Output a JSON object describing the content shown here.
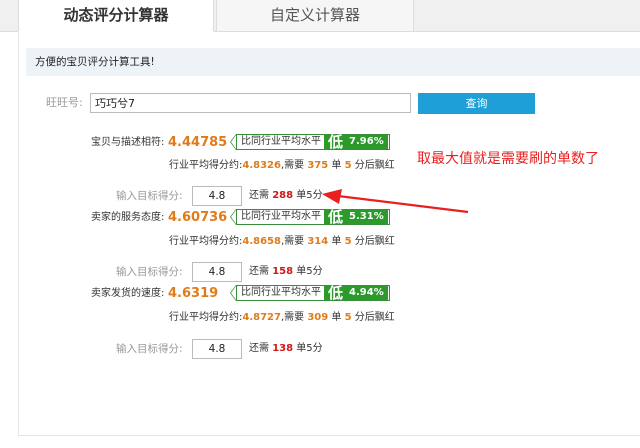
{
  "tabs": [
    {
      "label": "动态评分计算器",
      "active": true
    },
    {
      "label": "自定义计算器",
      "active": false
    }
  ],
  "notice": "方便的宝贝评分计算工具!",
  "search": {
    "label": "旺旺号:",
    "value": "巧巧兮7",
    "button": "查询"
  },
  "metrics": [
    {
      "label": "宝贝与描述相符:",
      "score": "4.44785",
      "compare_text": "比同行业平均水平",
      "level": "低",
      "percent": "7.96%",
      "avg_prefix": "行业平均得分约:",
      "avg": "4.8326",
      "need_prefix": ",需要",
      "need_count": "375",
      "unit1": "单",
      "star": "5",
      "suffix": "分后飘红",
      "target_label": "输入目标得分:",
      "target_value": "4.8",
      "remain_prefix": "还需",
      "remain_count": "288",
      "remain_suffix": "单5分"
    },
    {
      "label": "卖家的服务态度:",
      "score": "4.60736",
      "compare_text": "比同行业平均水平",
      "level": "低",
      "percent": "5.31%",
      "avg_prefix": "行业平均得分约:",
      "avg": "4.8658",
      "need_prefix": ",需要",
      "need_count": "314",
      "unit1": "单",
      "star": "5",
      "suffix": "分后飘红",
      "target_label": "输入目标得分:",
      "target_value": "4.8",
      "remain_prefix": "还需",
      "remain_count": "158",
      "remain_suffix": "单5分"
    },
    {
      "label": "卖家发货的速度:",
      "score": "4.6319",
      "compare_text": "比同行业平均水平",
      "level": "低",
      "percent": "4.94%",
      "avg_prefix": "行业平均得分约:",
      "avg": "4.8727",
      "need_prefix": ",需要",
      "need_count": "309",
      "unit1": "单",
      "star": "5",
      "suffix": "分后飘红",
      "target_label": "输入目标得分:",
      "target_value": "4.8",
      "remain_prefix": "还需",
      "remain_count": "138",
      "remain_suffix": "单5分"
    }
  ],
  "annotation": "取最大值就是需要刷的单数了",
  "colors": {
    "accent_blue": "#1e9fd8",
    "score_orange": "#e07b1a",
    "low_green": "#2b9a2b",
    "need_red": "#d01818",
    "annotation_red": "#e82020"
  }
}
